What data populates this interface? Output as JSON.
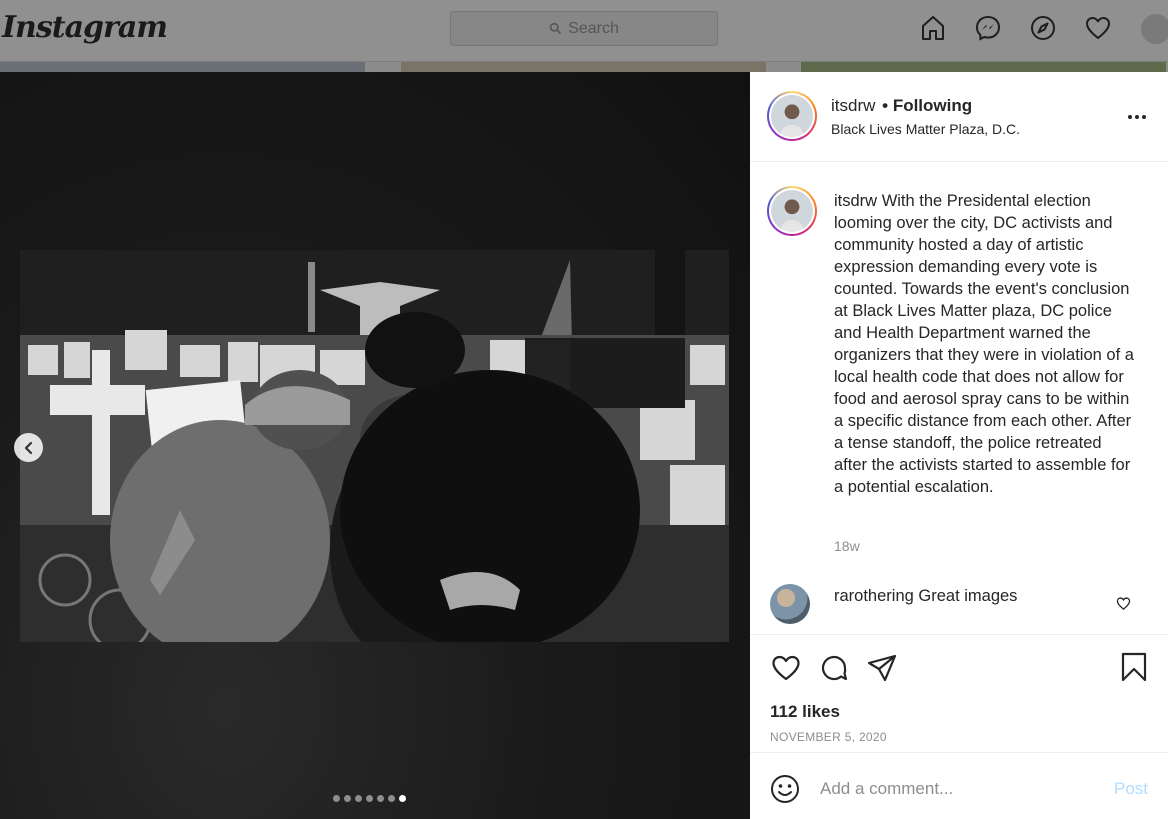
{
  "app": {
    "logo": "Instagram"
  },
  "topnav": {
    "search_placeholder": "Search",
    "icons": [
      "home-icon",
      "messenger-icon",
      "explore-icon",
      "activity-heart-icon",
      "profile-avatar"
    ]
  },
  "post": {
    "author": "itsdrw",
    "follow_status": "• Following",
    "location": "Black Lives Matter Plaza, D.C.",
    "caption_user": "itsdrw",
    "caption": "With the Presidental election looming over the city, DC activists and community hosted a day of artistic expression demanding every vote is counted. Towards the event's conclusion at Black Lives Matter plaza, DC police and Health Department warned the organizers that they were in violation of a local health code that does not allow for food and aerosol spray cans to be within a specific distance from each other. After a tense standoff, the police retreated after the activists started to assemble for a potential escalation.",
    "caption_time": "18w",
    "likes": "112 likes",
    "date": "NOVEMBER 5, 2020",
    "carousel": {
      "count": 7,
      "active_index": 6
    }
  },
  "comments": [
    {
      "user": "rarothering",
      "text": "Great images"
    }
  ],
  "composer": {
    "placeholder": "Add a comment...",
    "post_label": "Post"
  },
  "colors": {
    "accent_disabled": "#b3dbff",
    "muted": "#8e8e8e",
    "text": "#262626"
  }
}
